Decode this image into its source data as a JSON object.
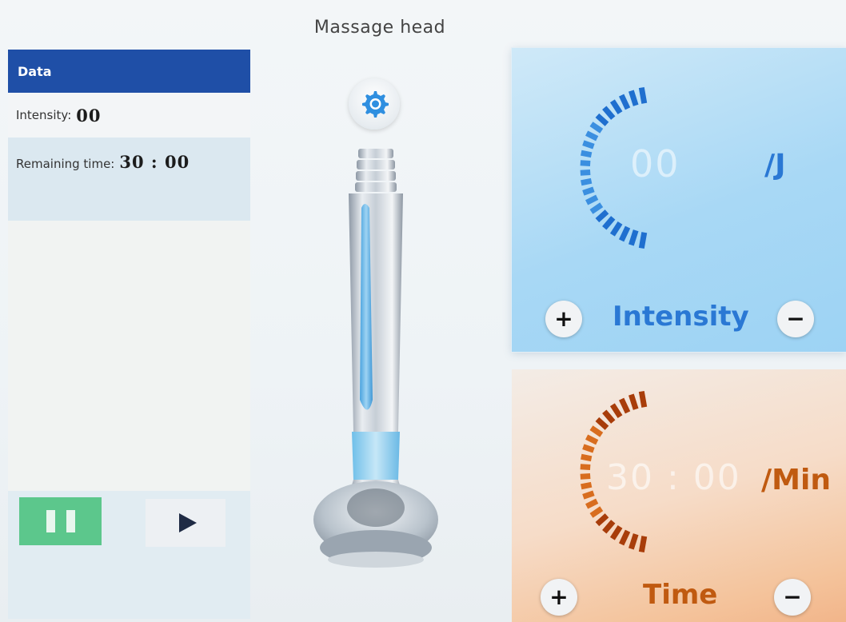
{
  "left_panel": {
    "header": "Data",
    "intensity_label": "Intensity:",
    "intensity_value": "00",
    "remaining_label": "Remaining time:",
    "remaining_value": "30 : 00"
  },
  "controls": {
    "pause_icon": "pause-icon",
    "play_icon": "play-icon"
  },
  "center": {
    "title": "Massage head",
    "settings_icon": "gear-icon"
  },
  "intensity_card": {
    "value": "00",
    "unit": "/J",
    "label": "Intensity",
    "plus": "+",
    "minus": "−",
    "accent": "#2a78d4"
  },
  "time_card": {
    "value": "30 : 00",
    "unit": "/Min",
    "label": "Time",
    "plus": "+",
    "minus": "−",
    "accent": "#c05a10"
  }
}
